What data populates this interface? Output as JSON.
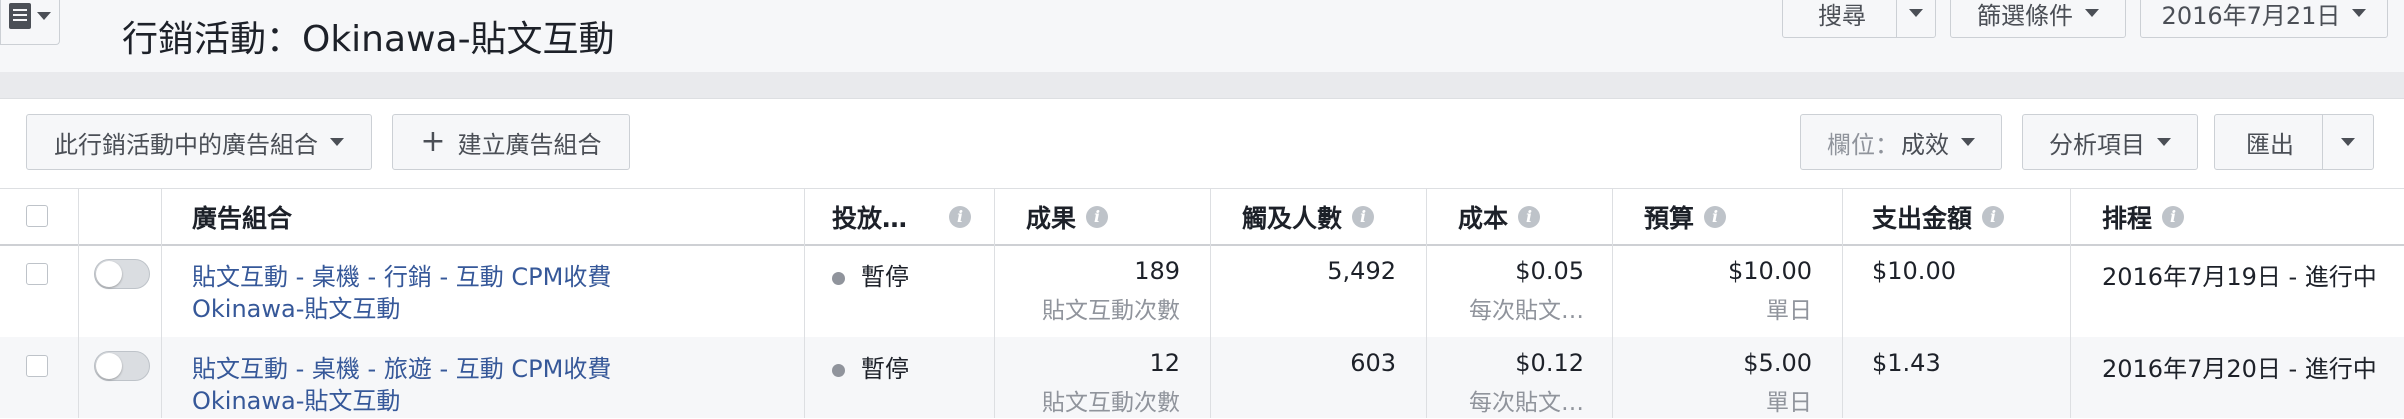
{
  "header": {
    "title": "行銷活動：Okinawa-貼文互動",
    "search_label": "搜尋",
    "filter_label": "篩選條件",
    "date_label": "2016年7月21日"
  },
  "toolbar": {
    "adset_dropdown_label": "此行銷活動中的廣告組合",
    "create_label": "建立廣告組合",
    "columns_prefix": "欄位：",
    "columns_value": "成效",
    "breakdown_label": "分析項目",
    "export_label": "匯出"
  },
  "table": {
    "headers": {
      "name": "廣告組合",
      "delivery": "投放…",
      "results": "成果",
      "reach": "觸及人數",
      "cost": "成本",
      "budget": "預算",
      "spent": "支出金額",
      "schedule": "排程"
    },
    "rows": [
      {
        "name": "貼文互動 - 桌機 - 行銷 - 互動 CPM收費",
        "campaign": "Okinawa-貼文互動",
        "delivery": "暫停",
        "results": "189",
        "results_sub": "貼文互動次數",
        "reach": "5,492",
        "cost": "$0.05",
        "cost_sub": "每次貼文…",
        "budget": "$10.00",
        "budget_sub": "單日",
        "spent": "$10.00",
        "schedule": "2016年7月19日 - 進行中"
      },
      {
        "name": "貼文互動 - 桌機 - 旅遊 - 互動 CPM收費",
        "campaign": "Okinawa-貼文互動",
        "delivery": "暫停",
        "results": "12",
        "results_sub": "貼文互動次數",
        "reach": "603",
        "cost": "$0.12",
        "cost_sub": "每次貼文…",
        "budget": "$5.00",
        "budget_sub": "單日",
        "spent": "$1.43",
        "schedule": "2016年7月20日 - 進行中"
      }
    ]
  },
  "colors": {
    "link": "#365899",
    "background": "#e9eaed",
    "muted": "#90949c"
  }
}
